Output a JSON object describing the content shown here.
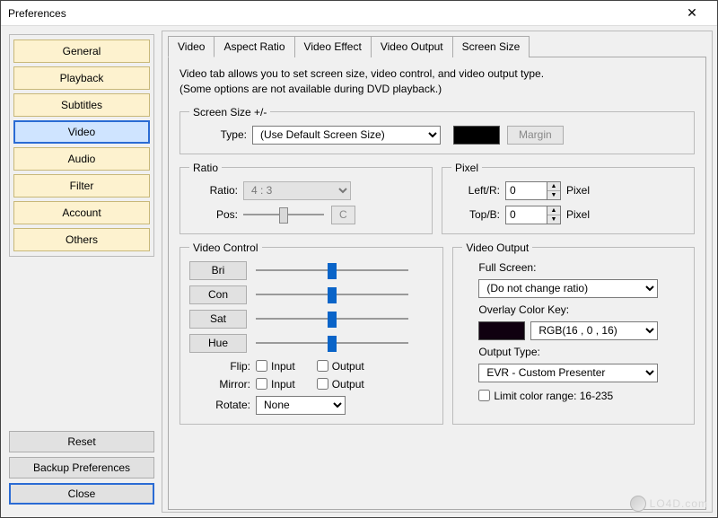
{
  "window": {
    "title": "Preferences"
  },
  "sidebar": {
    "items": [
      "General",
      "Playback",
      "Subtitles",
      "Video",
      "Audio",
      "Filter",
      "Account",
      "Others"
    ],
    "selected_index": 3
  },
  "bottom": {
    "reset": "Reset",
    "backup": "Backup Preferences",
    "close": "Close"
  },
  "tabs": {
    "items": [
      "Video",
      "Aspect Ratio",
      "Video Effect",
      "Video Output",
      "Screen Size"
    ],
    "active_index": 0
  },
  "intro": {
    "line1": "Video tab allows you to set screen size, video control, and video output type.",
    "line2": "(Some options are not available during DVD playback.)"
  },
  "screen_size": {
    "legend": "Screen Size +/-",
    "type_label": "Type:",
    "type_value": "(Use Default Screen Size)",
    "margin_btn": "Margin"
  },
  "ratio": {
    "legend": "Ratio",
    "ratio_label": "Ratio:",
    "ratio_value": "4 : 3",
    "pos_label": "Pos:",
    "c_btn": "C"
  },
  "pixel": {
    "legend": "Pixel",
    "left_label": "Left/R:",
    "top_label": "Top/B:",
    "left_val": "0",
    "top_val": "0",
    "unit": "Pixel"
  },
  "video_control": {
    "legend": "Video Control",
    "bri": "Bri",
    "con": "Con",
    "sat": "Sat",
    "hue": "Hue",
    "flip_label": "Flip:",
    "mirror_label": "Mirror:",
    "rotate_label": "Rotate:",
    "input": "Input",
    "output": "Output",
    "rotate_value": "None"
  },
  "video_output": {
    "legend": "Video Output",
    "fullscreen_label": "Full Screen:",
    "fullscreen_value": "(Do not change ratio)",
    "overlay_label": "Overlay Color Key:",
    "overlay_value": "RGB(16 , 0 , 16)",
    "output_type_label": "Output Type:",
    "output_type_value": "EVR - Custom Presenter",
    "limit_label": "Limit color range: 16-235"
  },
  "watermark": "LO4D.com"
}
